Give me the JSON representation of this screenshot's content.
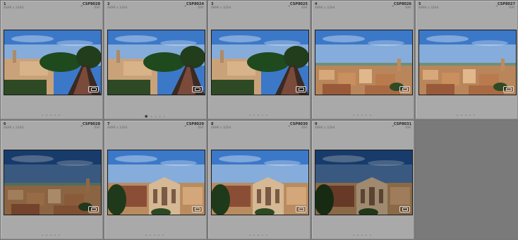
{
  "grid": {
    "cells": [
      {
        "index": "1",
        "dims": "4896 x 3264",
        "filename": "_CSP8028",
        "filetype": "RAF",
        "rating": 0,
        "scene": "street-gate"
      },
      {
        "index": "2",
        "dims": "4896 x 3264",
        "filename": "_CSP8024",
        "filetype": "RAF",
        "rating": 1,
        "scene": "street-gate"
      },
      {
        "index": "3",
        "dims": "4896 x 3264",
        "filename": "_CSP8025",
        "filetype": "RAF",
        "rating": 0,
        "scene": "street-gate"
      },
      {
        "index": "4",
        "dims": "4896 x 3264",
        "filename": "_CSP8026",
        "filetype": "RAF",
        "rating": 0,
        "scene": "rooftops"
      },
      {
        "index": "5",
        "dims": "4896 x 3264",
        "filename": "_CSP8027",
        "filetype": "RAF",
        "rating": 0,
        "scene": "rooftops"
      },
      {
        "index": "6",
        "dims": "4896 x 3264",
        "filename": "_CSP8028",
        "filetype": "RAF",
        "rating": 0,
        "scene": "rooftops-dark"
      },
      {
        "index": "7",
        "dims": "4896 x 3264",
        "filename": "_CSP8029",
        "filetype": "RAF",
        "rating": 0,
        "scene": "cathedral"
      },
      {
        "index": "8",
        "dims": "4896 x 3264",
        "filename": "_CSP8030",
        "filetype": "RAF",
        "rating": 0,
        "scene": "cathedral"
      },
      {
        "index": "9",
        "dims": "4896 x 3264",
        "filename": "_CSP8031",
        "filetype": "RAF",
        "rating": 0,
        "scene": "cathedral-dark"
      }
    ]
  },
  "colors": {
    "cell_bg": "#a9a9a9",
    "empty_bg": "#7a7a7a"
  }
}
